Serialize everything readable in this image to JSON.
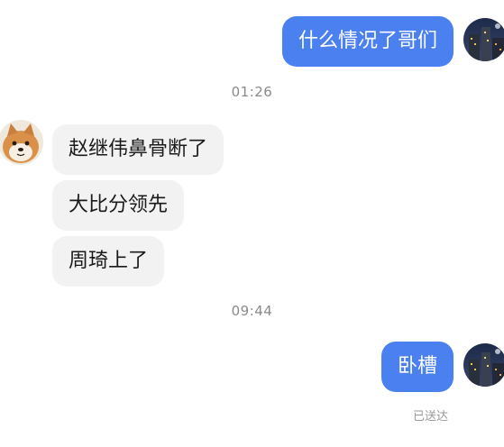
{
  "conversation": {
    "messages": [
      {
        "sender": "me",
        "text": "什么情况了哥们"
      },
      {
        "time": "01:26"
      },
      {
        "sender": "other",
        "text": "赵继伟鼻骨断了"
      },
      {
        "sender": "other",
        "text": "大比分领先"
      },
      {
        "sender": "other",
        "text": "周琦上了"
      },
      {
        "time": "09:44"
      },
      {
        "sender": "me",
        "text": "卧槽",
        "status": "已送达"
      }
    ]
  },
  "colors": {
    "sent_bubble": "#4a80f0",
    "received_bubble": "#f2f2f2",
    "timestamp_text": "#8a8a8a"
  },
  "avatars": {
    "me": "night-city-photo-avatar",
    "other": "shiba-dog-avatar"
  }
}
